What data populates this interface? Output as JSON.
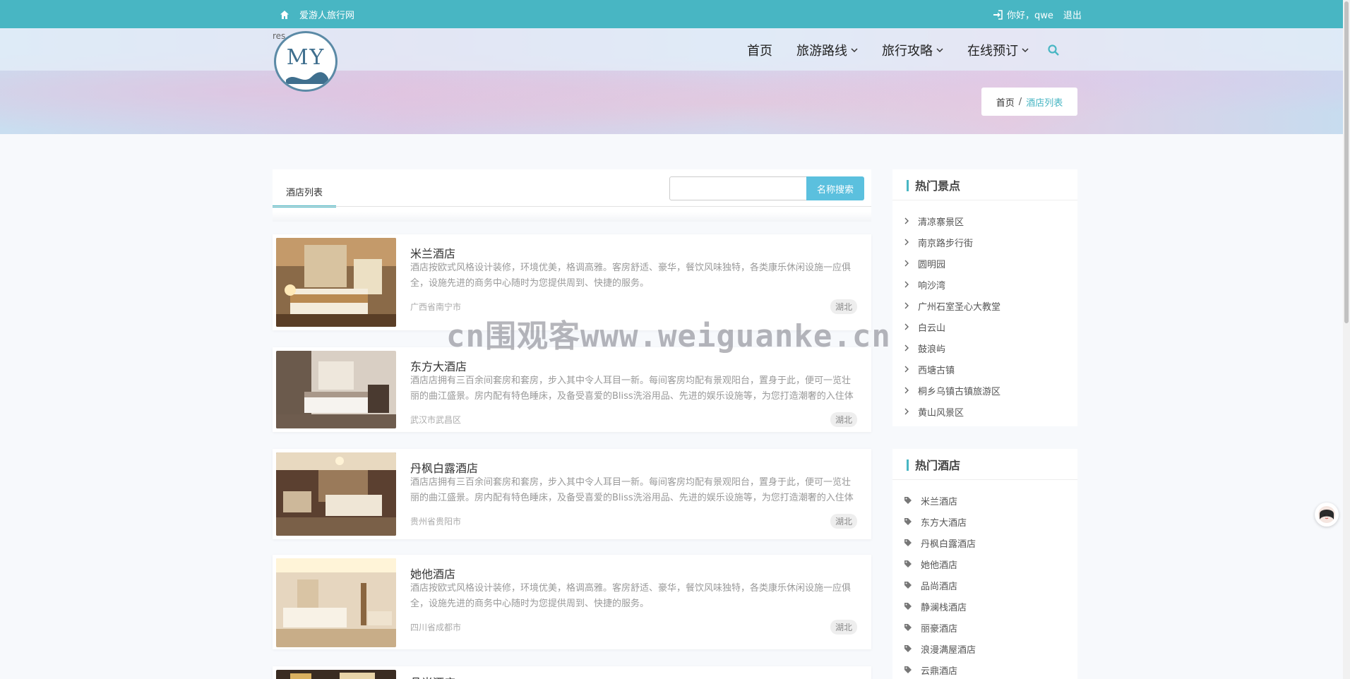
{
  "topbar": {
    "site_name": "爱游人旅行网",
    "greeting": "你好，qwe",
    "logout": "退出"
  },
  "header": {
    "logo_alt_text": "res",
    "logo_letters": "MY",
    "nav": [
      {
        "label": "首页"
      },
      {
        "label": "旅游路线"
      },
      {
        "label": "旅行攻略"
      },
      {
        "label": "在线预订"
      }
    ]
  },
  "breadcrumb": {
    "home": "首页",
    "separator": "/",
    "current": "酒店列表"
  },
  "main": {
    "tab_label": "酒店列表",
    "search_placeholder": "",
    "search_button": "名称搜索",
    "hotels": [
      {
        "name": "米兰酒店",
        "desc": "酒店按欧式风格设计装修，环境优美，格调高雅。客房舒适、豪华，餐饮风味独特，各类康乐休闲设施一应俱全，设施先进的商务中心随时为您提供周到、快捷的服务。",
        "location": "广西省南宁市",
        "tag": "湖北"
      },
      {
        "name": "东方大酒店",
        "desc": "酒店店拥有三百余间套房和套房，步入其中令人耳目一新。每间客房均配有景观阳台，置身于此，便可一览壮丽的曲江盛景。房内配有特色睡床，及备受喜爱的Bliss洗浴用品、先进的娱乐设施等，为您打造潮奢的入住体",
        "location": "武汉市武昌区",
        "tag": "湖北"
      },
      {
        "name": "丹枫白露酒店",
        "desc": "酒店店拥有三百余间套房和套房，步入其中令人耳目一新。每间客房均配有景观阳台，置身于此，便可一览壮丽的曲江盛景。房内配有特色睡床，及备受喜爱的Bliss洗浴用品、先进的娱乐设施等，为您打造潮奢的入住体",
        "location": "贵州省贵阳市",
        "tag": "湖北"
      },
      {
        "name": "她他酒店",
        "desc": "酒店按欧式风格设计装修，环境优美，格调高雅。客房舒适、豪华，餐饮风味独特，各类康乐休闲设施一应俱全，设施先进的商务中心随时为您提供周到、快捷的服务。",
        "location": "四川省成都市",
        "tag": "湖北"
      },
      {
        "name": "品尚酒店",
        "desc": "",
        "location": "",
        "tag": ""
      }
    ]
  },
  "sidebar": {
    "spots_title": "热门景点",
    "spots": [
      "清凉寨景区",
      "南京路步行街",
      "圆明园",
      "响沙湾",
      "广州石室圣心大教堂",
      "白云山",
      "鼓浪屿",
      "西塘古镇",
      "桐乡乌镇古镇旅游区",
      "黄山风景区"
    ],
    "hotels_title": "热门酒店",
    "hotels": [
      "米兰酒店",
      "东方大酒店",
      "丹枫白露酒店",
      "她他酒店",
      "品尚酒店",
      "静澜栈酒店",
      "丽豪酒店",
      "浪漫满屋酒店",
      "云鼎酒店"
    ]
  },
  "watermark": "cn围观客www.weiguanke.cn",
  "colors": {
    "accent": "#48b6c3",
    "search_button": "#5bc0de"
  }
}
